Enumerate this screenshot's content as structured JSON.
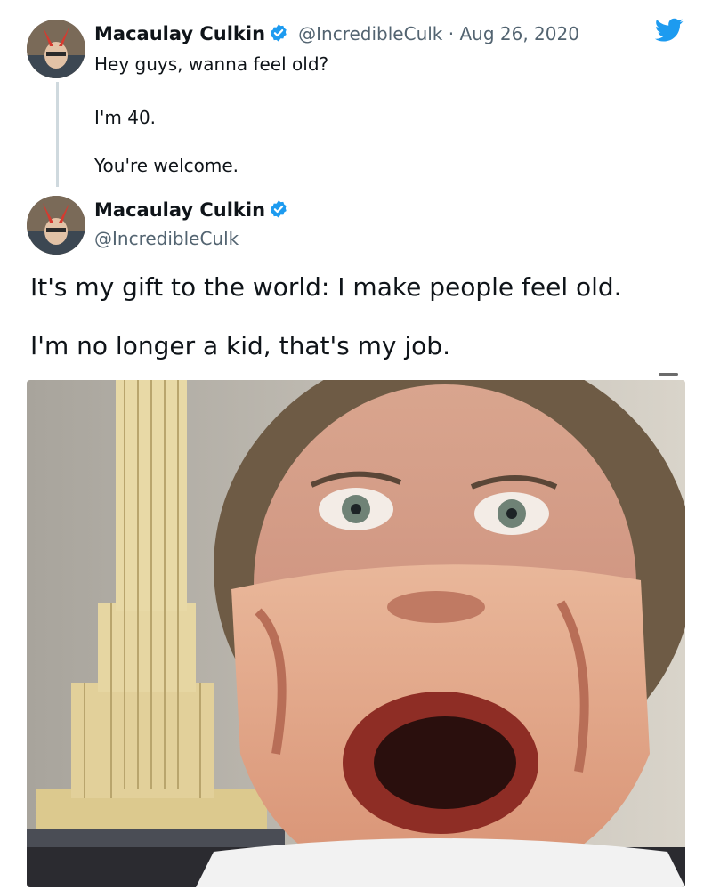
{
  "tweet_1": {
    "author_name": "Macaulay Culkin",
    "handle_and_date": "@IncredibleCulk · Aug 26, 2020",
    "lines": [
      "Hey guys, wanna feel old?",
      "I'm 40.",
      "You're welcome."
    ]
  },
  "tweet_2": {
    "author_name": "Macaulay Culkin",
    "handle": "@IncredibleCulk",
    "text_lines": [
      "It's my gift to the world: I make people feel old.",
      "I'm no longer a kid, that's my job."
    ]
  },
  "icons": {
    "verified": "verified-badge-icon",
    "brand": "twitter-bird-icon"
  },
  "colors": {
    "brand_blue": "#1d9bf0",
    "text": "#0f1419",
    "secondary_text": "#536471",
    "thread_line": "#cfd9de"
  }
}
